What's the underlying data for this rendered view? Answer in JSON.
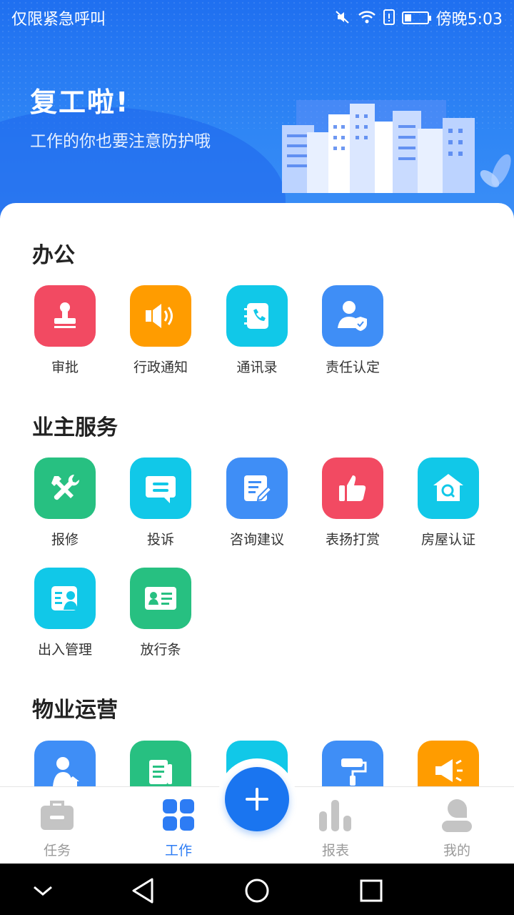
{
  "status_bar": {
    "carrier": "仅限紧急呼叫",
    "time": "傍晚5:03",
    "battery_level": 0.3,
    "icons": [
      "mute-icon",
      "wifi-icon",
      "sim-icon",
      "battery-icon"
    ]
  },
  "banner": {
    "title": "复工啦!",
    "subtitle": "工作的你也要注意防护哦"
  },
  "sections": [
    {
      "title": "办公",
      "items": [
        {
          "label": "审批",
          "icon": "stamp-icon",
          "color": "#f24a62"
        },
        {
          "label": "行政通知",
          "icon": "speaker-icon",
          "color": "#ff9c00"
        },
        {
          "label": "通讯录",
          "icon": "contacts-book-icon",
          "color": "#11c8e8"
        },
        {
          "label": "责任认定",
          "icon": "user-shield-icon",
          "color": "#3f8ef6"
        }
      ]
    },
    {
      "title": "业主服务",
      "items": [
        {
          "label": "报修",
          "icon": "tools-icon",
          "color": "#27c081"
        },
        {
          "label": "投诉",
          "icon": "message-icon",
          "color": "#11c8e8"
        },
        {
          "label": "咨询建议",
          "icon": "edit-note-icon",
          "color": "#3f8ef6"
        },
        {
          "label": "表扬打赏",
          "icon": "thumbs-up-icon",
          "color": "#f24a62"
        },
        {
          "label": "房屋认证",
          "icon": "house-search-icon",
          "color": "#11c8e8"
        },
        {
          "label": "出入管理",
          "icon": "access-card-icon",
          "color": "#11c8e8"
        },
        {
          "label": "放行条",
          "icon": "id-card-icon",
          "color": "#27c081"
        }
      ]
    },
    {
      "title": "物业运营",
      "items": [
        {
          "label": "",
          "icon": "user-home-icon",
          "color": "#3f8ef6"
        },
        {
          "label": "",
          "icon": "documents-icon",
          "color": "#27c081"
        },
        {
          "label": "",
          "icon": "bell-icon",
          "color": "#11c8e8"
        },
        {
          "label": "",
          "icon": "paint-roller-icon",
          "color": "#3f8ef6"
        },
        {
          "label": "",
          "icon": "megaphone-icon",
          "color": "#ff9c00"
        }
      ]
    }
  ],
  "tabbar": {
    "tabs": [
      {
        "label": "任务",
        "icon": "briefcase-icon",
        "active": false
      },
      {
        "label": "工作",
        "icon": "grid-icon",
        "active": true
      },
      {
        "label": "报表",
        "icon": "bar-chart-icon",
        "active": false
      },
      {
        "label": "我的",
        "icon": "person-icon",
        "active": false
      }
    ],
    "fab_icon": "plus-icon",
    "active_color": "#2d7cf4",
    "inactive_color": "#9a9a9a"
  },
  "system_nav": [
    "back-icon",
    "home-icon",
    "recents-icon",
    "collapse-icon"
  ]
}
